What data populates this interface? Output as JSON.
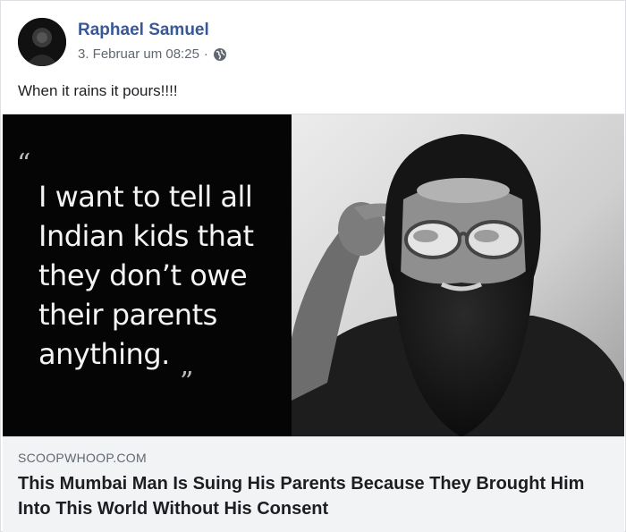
{
  "post": {
    "author": "Raphael Samuel",
    "timestamp": "3. Februar um 08:25",
    "separator": "·",
    "audience_icon": "globe-icon",
    "text": "When it rains it pours!!!!"
  },
  "media": {
    "quote_open": "“",
    "quote_lines": [
      "I want to tell all",
      "Indian kids that",
      "they don’t owe",
      "their parents",
      "anything."
    ],
    "quote_close": "”",
    "photo_subject": "bearded man with sunglasses pointing at temple"
  },
  "link": {
    "domain": "SCOOPWHOOP.COM",
    "title": "This Mumbai Man Is Suing His Parents Because They Brought Him Into This World Without His Consent"
  },
  "colors": {
    "author": "#385898",
    "meta": "#606770",
    "link_bg": "#f2f3f5",
    "quote_bg": "#050505"
  }
}
